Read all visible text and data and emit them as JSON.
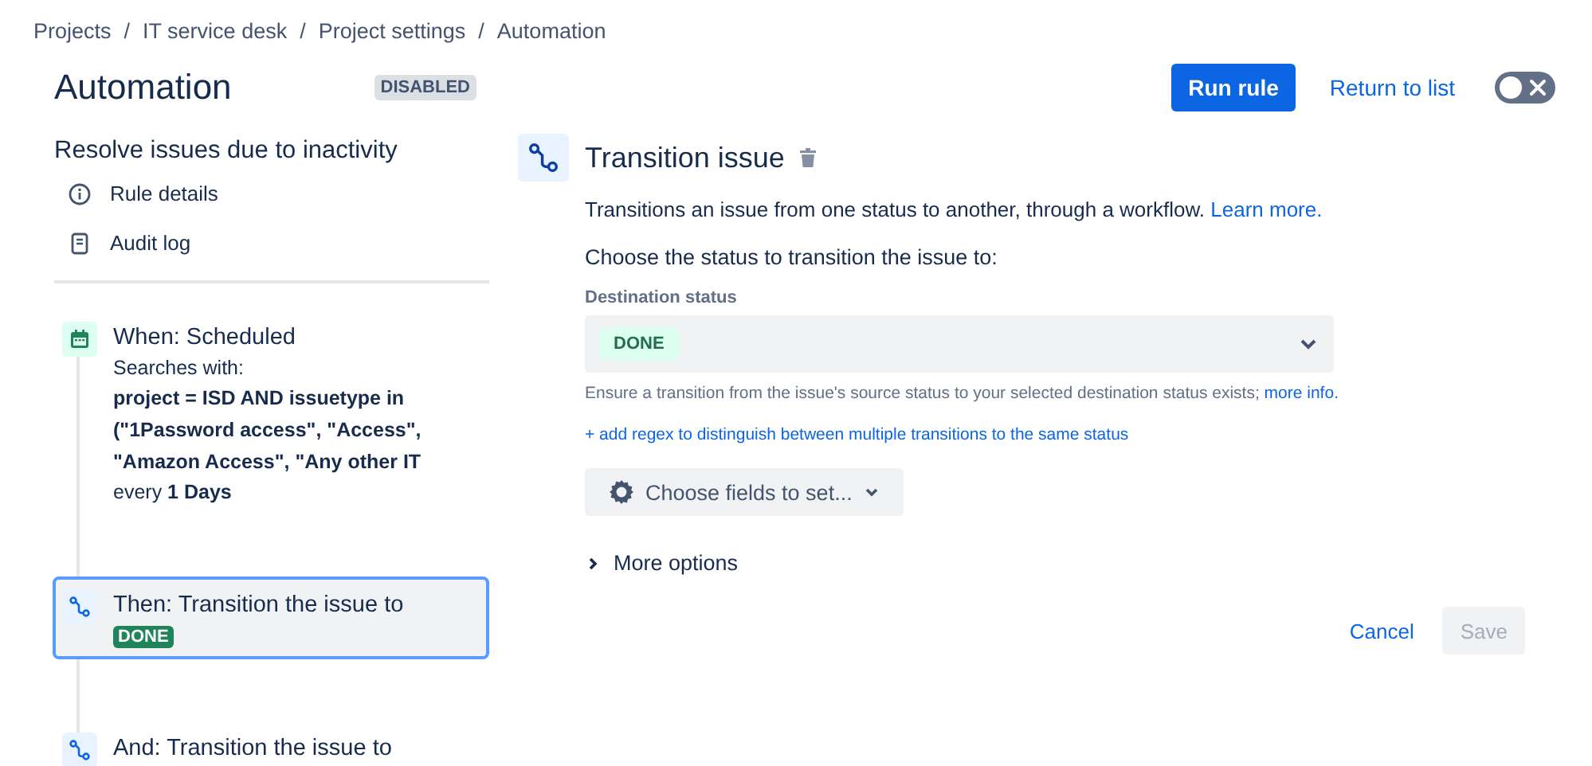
{
  "breadcrumbs": [
    {
      "label": "Projects"
    },
    {
      "separator": "/",
      "label": "IT service desk"
    },
    {
      "separator": "/",
      "label": "Project settings"
    },
    {
      "separator": "/",
      "label": "Automation"
    }
  ],
  "page": {
    "title": "Automation",
    "status_badge": "DISABLED"
  },
  "actions": {
    "run_button": "Run rule",
    "return_link": "Return to list",
    "toggle": {
      "on": false
    }
  },
  "rule": {
    "name": "Resolve issues due to inactivity"
  },
  "nav": [
    {
      "kind": "info",
      "label": "Rule details"
    },
    {
      "kind": "log",
      "label": "Audit log"
    }
  ],
  "steps": [
    {
      "kind": "trigger",
      "title": "When: Scheduled",
      "selected": false,
      "label": "Searches with:",
      "query_lines": [
        "project = ISD AND issuetype in",
        "(\"1Password access\", \"Access\",",
        "\"Amazon Access\", \"Any other IT"
      ],
      "schedule": "every **1 Days**"
    },
    {
      "kind": "action",
      "title": "Then: Transition the issue to",
      "selected": true,
      "status": "DONE"
    },
    {
      "kind": "action",
      "title": "And: Transition the issue to",
      "selected": false
    }
  ],
  "editor": {
    "title": "Transition issue",
    "description": "Transitions an issue from one status to another, through a workflow.",
    "learn_link": "Learn more.",
    "prompt": "Choose the status to transition the issue to:",
    "field_label": "Destination status",
    "field_value": "DONE",
    "help": "Ensure a transition from the issue's source status to your selected destination status exists;",
    "help_link": "more info.",
    "regex_link": "+ add regex to distinguish between multiple transitions to the same status",
    "fields_button": "Choose fields to set...",
    "more_options": {
      "label": "More options",
      "expanded": false
    },
    "cancel": "Cancel",
    "save": {
      "label": "Save",
      "disabled": true
    }
  }
}
